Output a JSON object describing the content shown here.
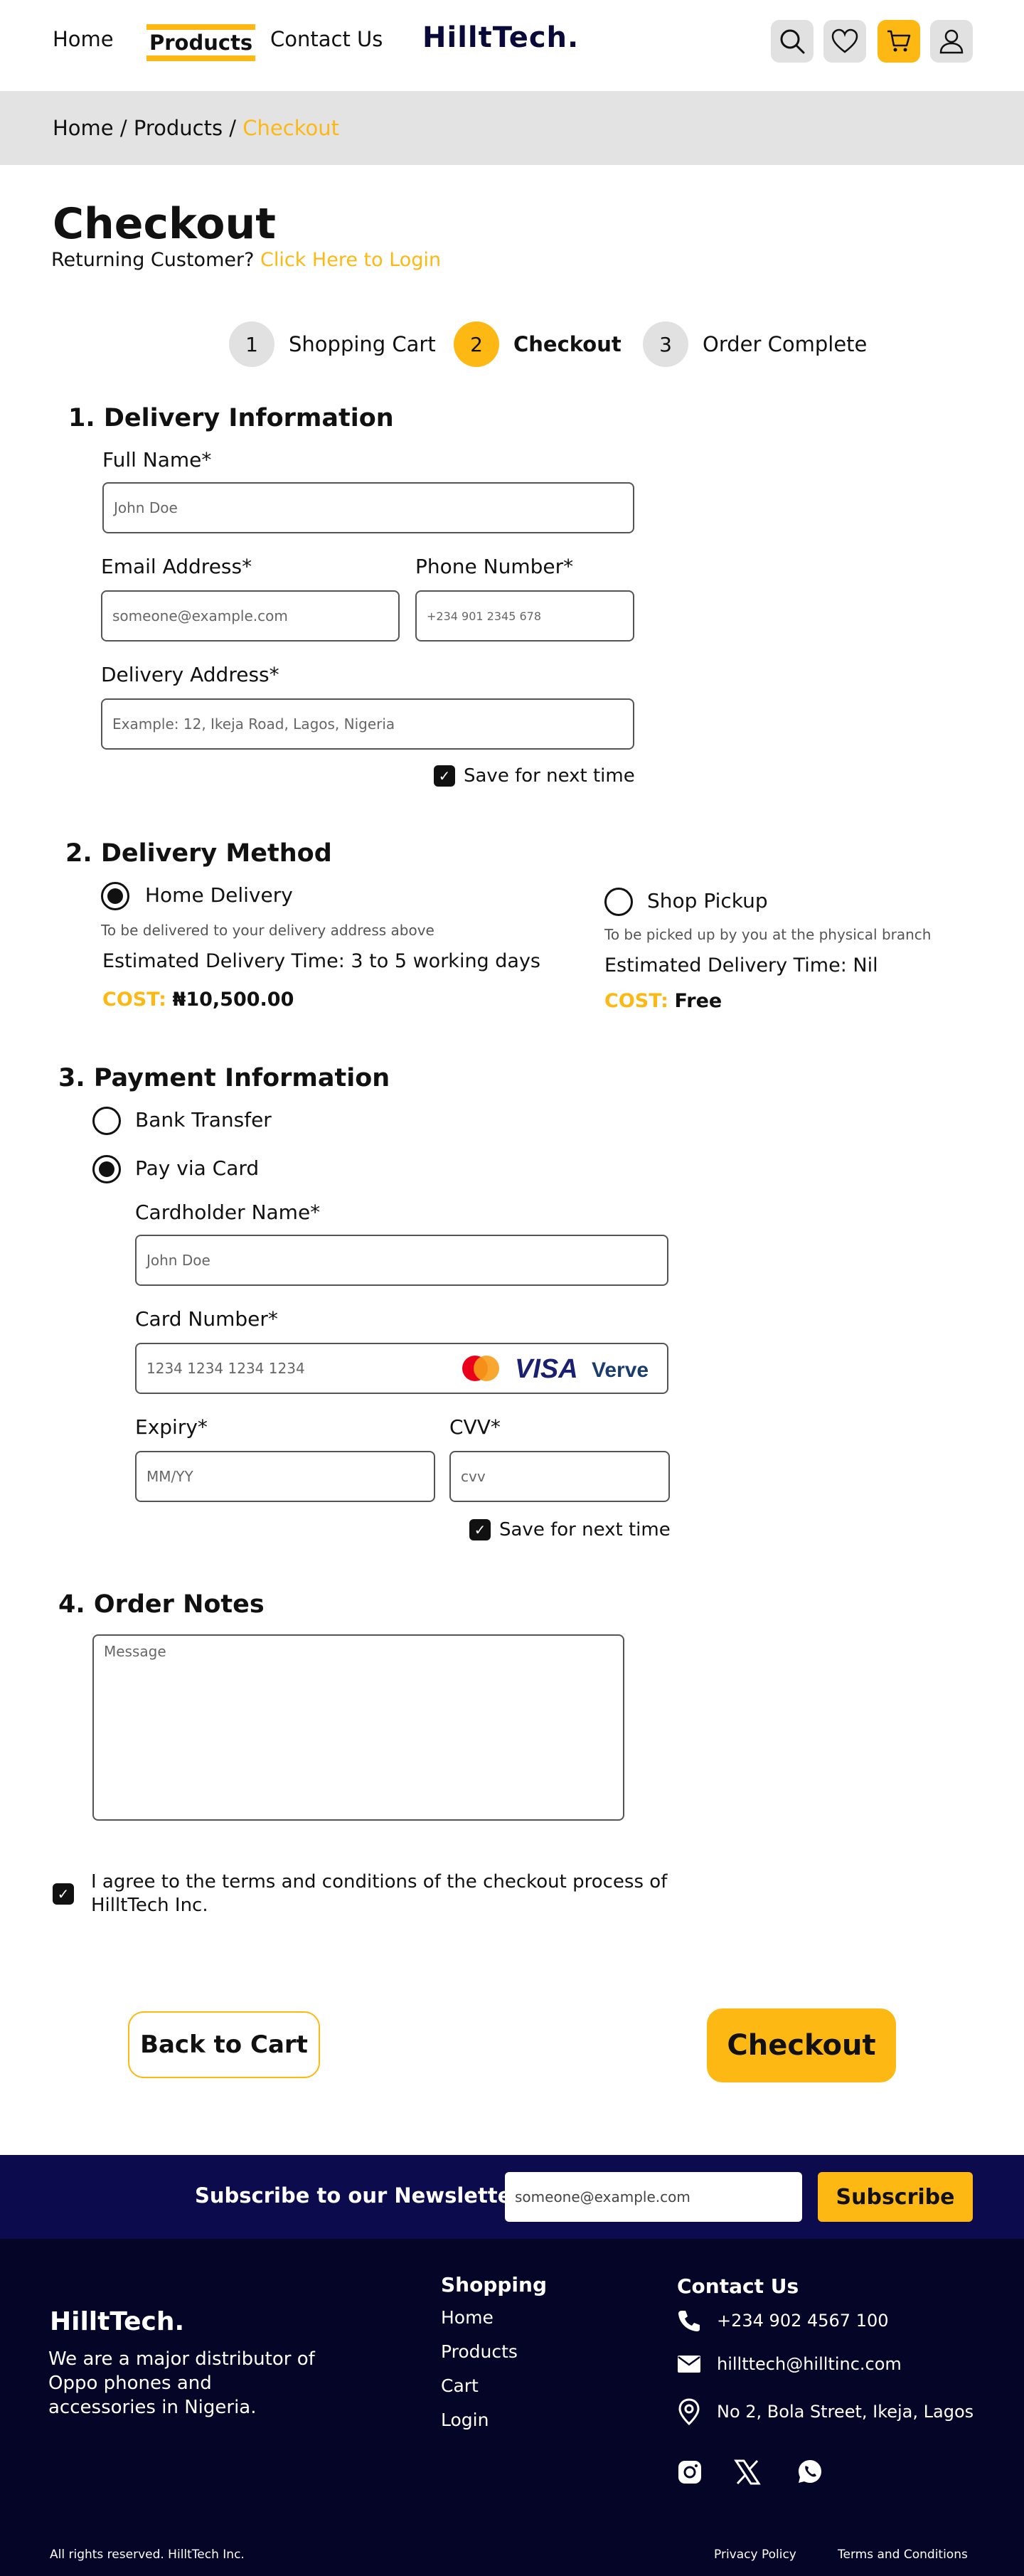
{
  "nav": {
    "home": "Home",
    "products": "Products",
    "contact": "Contact Us",
    "logo": "HilltTech."
  },
  "breadcrumb": {
    "home": "Home",
    "sep1": " / ",
    "products": "Products",
    "sep2": " / ",
    "current": "Checkout"
  },
  "page": {
    "title": "Checkout",
    "returning": "Returning Customer?",
    "login_link": "Click Here to Login"
  },
  "steps": [
    {
      "num": "1",
      "label": "Shopping Cart"
    },
    {
      "num": "2",
      "label": "Checkout"
    },
    {
      "num": "3",
      "label": "Order Complete"
    }
  ],
  "delivery_info": {
    "title": "1. Delivery Information",
    "full_name_label": "Full Name*",
    "full_name_ph": "John Doe",
    "email_label": "Email Address*",
    "email_ph": "someone@example.com",
    "phone_label": "Phone Number*",
    "phone_ph": "+234 901 2345 678",
    "address_label": "Delivery Address*",
    "address_ph": "Example: 12, Ikeja Road, Lagos, Nigeria",
    "save": "Save for next time"
  },
  "delivery_method": {
    "title": "2. Delivery Method",
    "home_label": "Home Delivery",
    "home_desc": "To be delivered to your delivery address above",
    "home_est": "Estimated Delivery Time: 3 to 5 working days",
    "home_cost_key": "COST:",
    "home_cost_val": "₦10,500.00",
    "pickup_label": "Shop Pickup",
    "pickup_desc": "To be picked up by you at the physical branch",
    "pickup_est": "Estimated Delivery Time: Nil",
    "pickup_cost_key": "COST:",
    "pickup_cost_val": "Free"
  },
  "payment": {
    "title": "3. Payment Information",
    "bank": "Bank Transfer",
    "card": "Pay via Card",
    "holder_label": "Cardholder Name*",
    "holder_ph": "John Doe",
    "number_label": "Card Number*",
    "number_ph": "1234 1234 1234 1234",
    "visa": "VISA",
    "verve": "Verve",
    "expiry_label": "Expiry*",
    "expiry_ph": "MM/YY",
    "cvv_label": "CVV*",
    "cvv_ph": "cvv",
    "save": "Save for next time"
  },
  "notes": {
    "title": "4. Order Notes",
    "ph": "Message"
  },
  "terms": "I agree to the terms and conditions of the checkout process of HilltTech Inc.",
  "buttons": {
    "back": "Back to Cart",
    "checkout": "Checkout"
  },
  "newsletter": {
    "title": "Subscribe to our Newsletter",
    "ph": "someone@example.com",
    "button": "Subscribe"
  },
  "footer": {
    "logo": "HilltTech.",
    "desc": "We are a major distributor of Oppo phones and accessories in Nigeria.",
    "shopping_title": "Shopping",
    "shopping_links": [
      "Home",
      "Products",
      "Cart",
      "Login"
    ],
    "contact_title": "Contact Us",
    "phone": "+234 902 4567 100",
    "email": "hillttech@hilltinc.com",
    "address": "No 2, Bola Street, Ikeja, Lagos",
    "copyright": "All rights reserved. HilltTech Inc.",
    "privacy": "Privacy Policy",
    "terms": "Terms and Conditions"
  },
  "colors": {
    "accent": "#FDB813",
    "navy": "#0b0b4d",
    "footer_bg": "#050528"
  }
}
